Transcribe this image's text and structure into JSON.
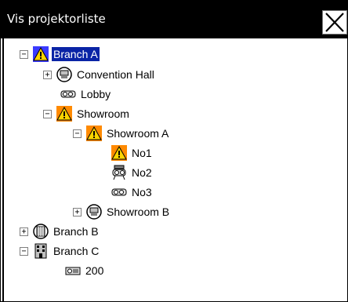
{
  "window": {
    "title": "Vis projektorliste",
    "close_symbol": "X"
  },
  "tree": {
    "expand_symbol": "+",
    "collapse_symbol": "−",
    "items": [
      {
        "label": "Branch A",
        "expander": "collapse",
        "icon": "warning-icon",
        "selected": true
      },
      {
        "label": "Convention Hall",
        "expander": "expand",
        "icon": "building-round-icon"
      },
      {
        "label": "Lobby",
        "icon": "projector-icon"
      },
      {
        "label": "Showroom",
        "expander": "collapse",
        "icon": "warning-icon"
      },
      {
        "label": "Showroom A",
        "expander": "collapse",
        "icon": "warning-icon"
      },
      {
        "label": "No1",
        "icon": "warning-icon"
      },
      {
        "label": "No2",
        "icon": "projector-stand-icon"
      },
      {
        "label": "No3",
        "icon": "projector-icon"
      },
      {
        "label": "Showroom B",
        "expander": "expand",
        "icon": "building-round-icon"
      },
      {
        "label": "Branch B",
        "expander": "expand",
        "icon": "globe-icon"
      },
      {
        "label": "Branch C",
        "expander": "collapse",
        "icon": "building-icon"
      },
      {
        "label": "200",
        "icon": "projector-flat-icon"
      }
    ]
  }
}
